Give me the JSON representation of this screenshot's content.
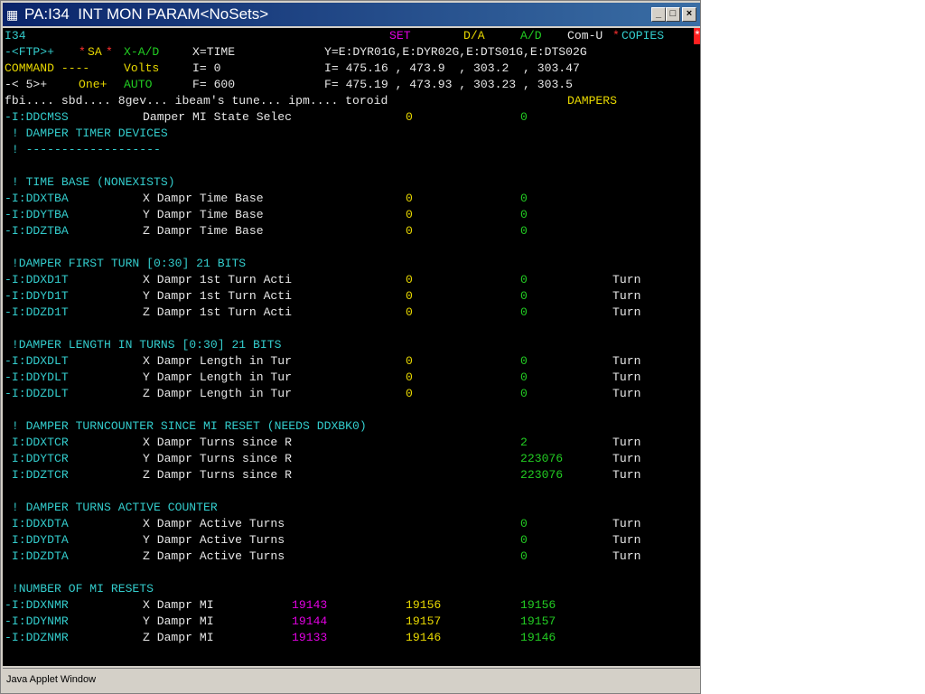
{
  "window": {
    "title": "PA:I34  INT MON PARAM<NoSets>",
    "icon": "app-icon",
    "buttons": [
      "_",
      "□",
      "×"
    ]
  },
  "header": {
    "line1": {
      "page": "I34",
      "set": "SET",
      "da": "D/A",
      "ad": "A/D",
      "comu": "Com-U",
      "copies_star": "*",
      "copies": "COPIES",
      "copies_mark": "*"
    },
    "line2": {
      "ftp": "-<FTP>+",
      "sa_star": "*",
      "sa": "SA",
      "sa_mark": "*",
      "xad": "X-A/D",
      "xeq": "X=TIME",
      "yeq": "Y=E:DYR01G,E:DYR02G,E:DTS01G,E:DTS02G"
    },
    "line3": {
      "cmd": "COMMAND ----",
      "volts": "Volts",
      "ieq": "I= 0",
      "ivals": "I= 475.16 , 473.9  , 303.2  , 303.47"
    },
    "line4": {
      "sets": "-< 5>+",
      "one": "One+",
      "auto": "AUTO",
      "feq": "F= 600",
      "fvals": "F= 475.19 , 473.93 , 303.23 , 303.5"
    },
    "line5": {
      "menu": "fbi.... sbd.... 8gev... ibeam's tune... ipm.... toroid",
      "dampers": "DAMPERS"
    }
  },
  "rows": [
    {
      "name": "-I:DDCMSS",
      "desc": "Damper MI State Selec",
      "v1": "0",
      "v3": "0"
    },
    {
      "comment": " ! DAMPER TIMER DEVICES"
    },
    {
      "comment": " ! -------------------"
    },
    {
      "comment": ""
    },
    {
      "comment": " ! TIME BASE (NONEXISTS)"
    },
    {
      "name": "-I:DDXTBA",
      "desc": "X Dampr Time Base",
      "v1": "0",
      "v3": "0"
    },
    {
      "name": "-I:DDYTBA",
      "desc": "Y Dampr Time Base",
      "v1": "0",
      "v3": "0"
    },
    {
      "name": "-I:DDZTBA",
      "desc": "Z Dampr Time Base",
      "v1": "0",
      "v3": "0"
    },
    {
      "comment": ""
    },
    {
      "comment": " !DAMPER FIRST TURN [0:30] 21 BITS"
    },
    {
      "name": "-I:DDXD1T",
      "desc": "X Dampr 1st Turn Acti",
      "v1": "0",
      "v3": "0",
      "unit": "Turn"
    },
    {
      "name": "-I:DDYD1T",
      "desc": "Y Dampr 1st Turn Acti",
      "v1": "0",
      "v3": "0",
      "unit": "Turn"
    },
    {
      "name": "-I:DDZD1T",
      "desc": "Z Dampr 1st Turn Acti",
      "v1": "0",
      "v3": "0",
      "unit": "Turn"
    },
    {
      "comment": ""
    },
    {
      "comment": " !DAMPER LENGTH IN TURNS [0:30] 21 BITS"
    },
    {
      "name": "-I:DDXDLT",
      "desc": "X Dampr Length in Tur",
      "v1": "0",
      "v3": "0",
      "unit": "Turn"
    },
    {
      "name": "-I:DDYDLT",
      "desc": "Y Dampr Length in Tur",
      "v1": "0",
      "v3": "0",
      "unit": "Turn"
    },
    {
      "name": "-I:DDZDLT",
      "desc": "Z Dampr Length in Tur",
      "v1": "0",
      "v3": "0",
      "unit": "Turn"
    },
    {
      "comment": ""
    },
    {
      "comment": " ! DAMPER TURNCOUNTER SINCE MI RESET (NEEDS DDXBK0)"
    },
    {
      "name": " I:DDXTCR",
      "desc": "X Dampr Turns since R",
      "v3": "2",
      "unit": "Turn"
    },
    {
      "name": " I:DDYTCR",
      "desc": "Y Dampr Turns since R",
      "v3": "223076",
      "unit": "Turn"
    },
    {
      "name": " I:DDZTCR",
      "desc": "Z Dampr Turns since R",
      "v3": "223076",
      "unit": "Turn"
    },
    {
      "comment": ""
    },
    {
      "comment": " ! DAMPER TURNS ACTIVE COUNTER"
    },
    {
      "name": " I:DDXDTA",
      "desc": "X Dampr Active Turns",
      "v3": "0",
      "unit": "Turn"
    },
    {
      "name": " I:DDYDTA",
      "desc": "Y Dampr Active Turns",
      "v3": "0",
      "unit": "Turn"
    },
    {
      "name": " I:DDZDTA",
      "desc": "Z Dampr Active Turns",
      "v3": "0",
      "unit": "Turn"
    },
    {
      "comment": ""
    },
    {
      "comment": " !NUMBER OF MI RESETS"
    },
    {
      "name": "-I:DDXNMR",
      "desc": "X Dampr MI",
      "set": "19143",
      "v1": "19156",
      "v3": "19156"
    },
    {
      "name": "-I:DDYNMR",
      "desc": "Y Dampr MI",
      "set": "19144",
      "v1": "19157",
      "v3": "19157"
    },
    {
      "name": "-I:DDZNMR",
      "desc": "Z Dampr MI",
      "set": "19133",
      "v1": "19146",
      "v3": "19146"
    }
  ],
  "status_bar": {
    "text": "Java Applet Window"
  }
}
